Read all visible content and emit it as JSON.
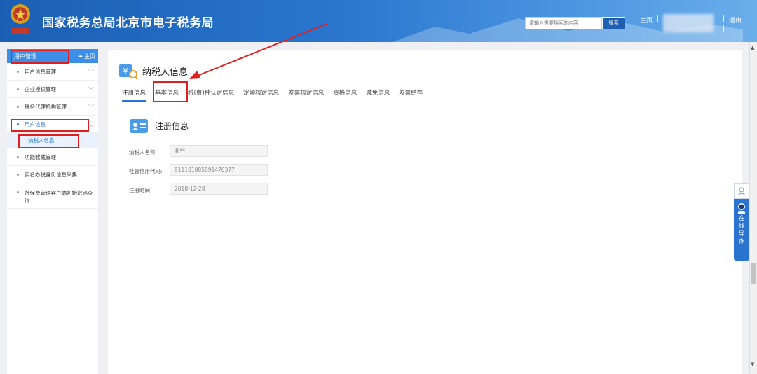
{
  "header": {
    "title": "国家税务总局北京市电子税务局",
    "search_placeholder": "请输入需要搜索的内容",
    "search_button": "搜索",
    "home_link": "主页",
    "logout_link": "退出",
    "separator": "|"
  },
  "sidebar": {
    "header_label": "用户管理",
    "home_label": "主页",
    "items": [
      {
        "label": "用户信息管理"
      },
      {
        "label": "企业授权管理"
      },
      {
        "label": "税务代理机构管理"
      },
      {
        "label": "用户信息"
      },
      {
        "label": "功能收藏管理"
      },
      {
        "label": "实名办税身份信息采集"
      },
      {
        "label": "社保费管理客户端初始密码查询"
      }
    ],
    "sub_item": "纳税人信息"
  },
  "main": {
    "page_title": "纳税人信息",
    "tabs": [
      "注册信息",
      "基本信息",
      "税(费)种认定信息",
      "定额核定信息",
      "发票核定信息",
      "资格信息",
      "减免信息",
      "发票结存"
    ],
    "section_title": "注册信息",
    "fields": [
      {
        "label": "纳税人名称:",
        "value": "北**"
      },
      {
        "label": "社会信用代码:",
        "value": "911101085891476377"
      },
      {
        "label": "注册时间:",
        "value": "2018-12-28"
      }
    ]
  },
  "float_widget": {
    "chars": [
      "在",
      "线",
      "导",
      "办"
    ]
  },
  "colors": {
    "header_blue": "#1a5fb4",
    "accent": "#2a74cf",
    "annotation_red": "#e02020"
  }
}
